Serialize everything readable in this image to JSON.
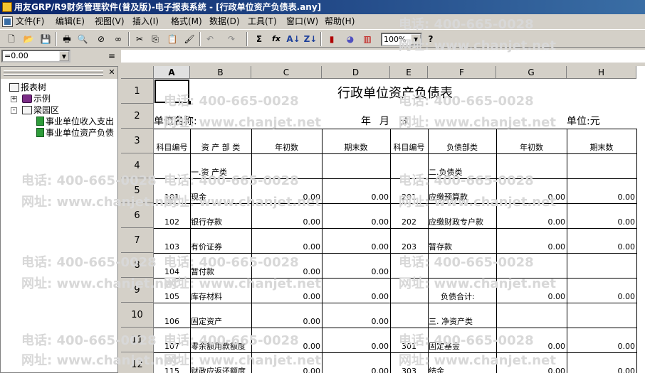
{
  "window": {
    "title": "用友GRP/R9财务管理软件(普及版)-电子报表系统 - [行政单位资产负债表.any]"
  },
  "menu": [
    "文件(F)",
    "编辑(E)",
    "视图(V)",
    "插入(I)",
    "格式(M)",
    "数据(D)",
    "工具(T)",
    "窗口(W)",
    "帮助(H)"
  ],
  "toolbar": {
    "zoom": "100%",
    "sum_label": "Σ",
    "fx_label": "fx",
    "help_label": "?"
  },
  "formula": {
    "cellref": "=0.00",
    "equals": "="
  },
  "tree": {
    "root": "报表树",
    "items": [
      {
        "label": "示例",
        "expander": "+"
      },
      {
        "label": "梁园区",
        "expander": "-"
      },
      {
        "label": "事业单位收入支出"
      },
      {
        "label": "事业单位资产负债"
      }
    ],
    "close": "✕"
  },
  "columns": [
    "A",
    "B",
    "C",
    "D",
    "E",
    "F",
    "G",
    "H"
  ],
  "rows": [
    "1",
    "2",
    "3",
    "4",
    "5",
    "6",
    "7",
    "8",
    "9",
    "10",
    "11",
    "12"
  ],
  "report": {
    "title": "行政单位资产负债表",
    "unit_name_label": "单位名称:",
    "date_year": "年",
    "date_month": "月",
    "date_day": "日",
    "unit_label": "单位:元",
    "headers": [
      "科目编号",
      "资 产 部 类",
      "年初数",
      "期末数",
      "科目编号",
      "负债部类",
      "年初数",
      "期末数"
    ],
    "section_assets": "一.资 产类",
    "section_liab": "二.负债类",
    "section_net": "三. 净资产类",
    "data_rows": [
      {
        "row": 5,
        "code_a": "101",
        "name_a": "现金",
        "init_a": "0.00",
        "end_a": "0.00",
        "code_b": "201",
        "name_b": "应缴预算款",
        "init_b": "0.00",
        "end_b": "0.00"
      },
      {
        "row": 6,
        "code_a": "102",
        "name_a": "银行存款",
        "init_a": "0.00",
        "end_a": "0.00",
        "code_b": "202",
        "name_b": "应缴财政专户款",
        "init_b": "0.00",
        "end_b": "0.00"
      },
      {
        "row": 7,
        "code_a": "103",
        "name_a": "有价证券",
        "init_a": "0.00",
        "end_a": "0.00",
        "code_b": "203",
        "name_b": "暂存款",
        "init_b": "0.00",
        "end_b": "0.00"
      },
      {
        "row": 8,
        "code_a": "104",
        "name_a": "暂付款",
        "init_a": "0.00",
        "end_a": "0.00",
        "code_b": "",
        "name_b": "",
        "init_b": "",
        "end_b": ""
      },
      {
        "row": 9,
        "code_a": "105",
        "name_a": "库存材料",
        "init_a": "0.00",
        "end_a": "0.00",
        "code_b": "",
        "name_b": "负债合计:",
        "init_b": "0.00",
        "end_b": "0.00"
      },
      {
        "row": 10,
        "code_a": "106",
        "name_a": "固定资产",
        "init_a": "0.00",
        "end_a": "0.00",
        "code_b": "",
        "name_b": "三. 净资产类",
        "init_b": "",
        "end_b": ""
      },
      {
        "row": 11,
        "code_a": "107",
        "name_a": "零余额用款额度",
        "init_a": "0.00",
        "end_a": "0.00",
        "code_b": "301",
        "name_b": "固定基金",
        "init_b": "0.00",
        "end_b": "0.00"
      },
      {
        "row": 12,
        "code_a": "115",
        "name_a": "财政应返还额度",
        "init_a": "0.00",
        "end_a": "0.00",
        "code_b": "303",
        "name_b": "结余",
        "init_b": "0.00",
        "end_b": "0.00"
      }
    ]
  },
  "watermark": {
    "phone": "电话: 400-665-0028",
    "site": "网址: www.chanjet.net"
  }
}
